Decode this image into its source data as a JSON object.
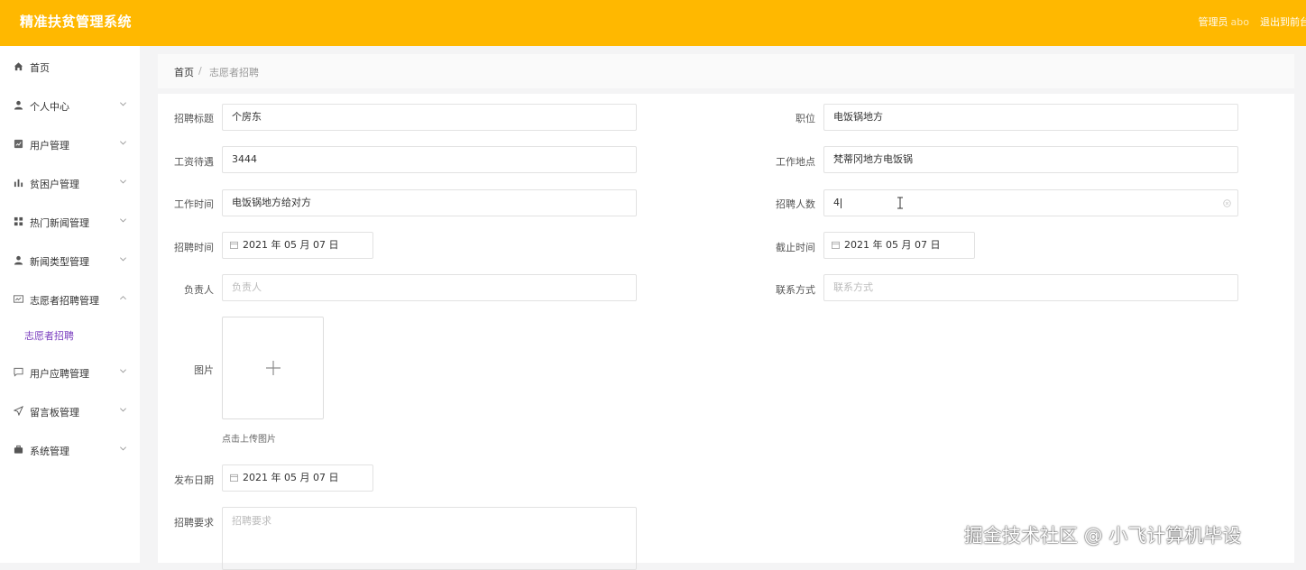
{
  "app": {
    "title": "精准扶贫管理系统"
  },
  "header": {
    "role_label": "管理员",
    "username": "abo",
    "logout_label": "退出到前台"
  },
  "sidebar": {
    "items": [
      {
        "label": "首页",
        "icon": "home-icon"
      },
      {
        "label": "个人中心",
        "icon": "user-icon"
      },
      {
        "label": "用户管理",
        "icon": "edit-icon"
      },
      {
        "label": "贫困户管理",
        "icon": "bar-chart-icon"
      },
      {
        "label": "热门新闻管理",
        "icon": "grid-icon"
      },
      {
        "label": "新闻类型管理",
        "icon": "user-icon"
      },
      {
        "label": "志愿者招聘管理",
        "icon": "card-icon"
      },
      {
        "label": "用户应聘管理",
        "icon": "message-icon"
      },
      {
        "label": "留言板管理",
        "icon": "send-icon"
      },
      {
        "label": "系统管理",
        "icon": "briefcase-icon"
      }
    ],
    "subitem": {
      "label": "志愿者招聘"
    }
  },
  "breadcrumb": {
    "home": "首页",
    "separator": "/",
    "current": "志愿者招聘"
  },
  "form": {
    "title": {
      "label": "招聘标题",
      "value": "个房东"
    },
    "position": {
      "label": "职位",
      "value": "电饭锅地方"
    },
    "salary": {
      "label": "工资待遇",
      "value": "3444"
    },
    "location": {
      "label": "工作地点",
      "value": "梵蒂冈地方电饭锅"
    },
    "work_time": {
      "label": "工作时间",
      "value": "电饭锅地方给对方"
    },
    "headcount": {
      "label": "招聘人数",
      "value": "4"
    },
    "recruit_time": {
      "label": "招聘时间",
      "value": "2021 年 05 月 07 日"
    },
    "deadline": {
      "label": "截止时间",
      "value": "2021 年 05 月 07 日"
    },
    "manager": {
      "label": "负责人",
      "placeholder": "负责人"
    },
    "contact": {
      "label": "联系方式",
      "placeholder": "联系方式"
    },
    "image": {
      "label": "图片",
      "hint": "点击上传图片"
    },
    "publish_date": {
      "label": "发布日期",
      "value": "2021 年 05 月 07 日"
    },
    "requirements": {
      "label": "招聘要求",
      "placeholder": "招聘要求"
    }
  },
  "watermark": "掘金技术社区 @ 小飞计算机毕设",
  "colors": {
    "header": "#ffb800",
    "submenu_active": "#7b3fbf"
  }
}
